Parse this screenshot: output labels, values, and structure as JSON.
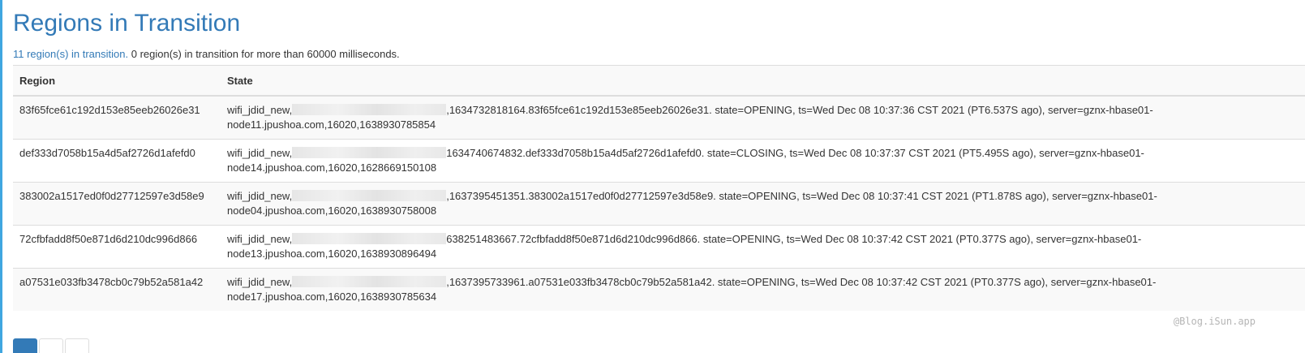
{
  "page": {
    "title": "Regions in Transition",
    "summary_link": "11 region(s) in transition.",
    "summary_text": " 0 region(s) in transition for more than 60000 milliseconds."
  },
  "table": {
    "columns": [
      "Region",
      "State"
    ],
    "rows": [
      {
        "region": "83f65fce61c192d153e85eeb26026e31",
        "state_prefix": "wifi_jdid_new,",
        "state_suffix": ",1634732818164.83f65fce61c192d153e85eeb26026e31. state=OPENING, ts=Wed Dec 08 10:37:36 CST 2021 (PT6.537S ago), server=gznx-hbase01-node11.jpushoa.com,16020,1638930785854"
      },
      {
        "region": "def333d7058b15a4d5af2726d1afefd0",
        "state_prefix": "wifi_jdid_new,",
        "state_suffix": "1634740674832.def333d7058b15a4d5af2726d1afefd0. state=CLOSING, ts=Wed Dec 08 10:37:37 CST 2021 (PT5.495S ago), server=gznx-hbase01-node14.jpushoa.com,16020,1628669150108"
      },
      {
        "region": "383002a1517ed0f0d27712597e3d58e9",
        "state_prefix": "wifi_jdid_new,",
        "state_suffix": ",1637395451351.383002a1517ed0f0d27712597e3d58e9. state=OPENING, ts=Wed Dec 08 10:37:41 CST 2021 (PT1.878S ago), server=gznx-hbase01-node04.jpushoa.com,16020,1638930758008"
      },
      {
        "region": "72cfbfadd8f50e871d6d210dc996d866",
        "state_prefix": "wifi_jdid_new,",
        "state_suffix": "638251483667.72cfbfadd8f50e871d6d210dc996d866. state=OPENING, ts=Wed Dec 08 10:37:42 CST 2021 (PT0.377S ago), server=gznx-hbase01-node13.jpushoa.com,16020,1638930896494"
      },
      {
        "region": "a07531e033fb3478cb0c79b52a581a42",
        "state_prefix": "wifi_jdid_new,",
        "state_suffix": ",1637395733961.a07531e033fb3478cb0c79b52a581a42. state=OPENING, ts=Wed Dec 08 10:37:42 CST 2021 (PT0.377S ago), server=gznx-hbase01-node17.jpushoa.com,16020,1638930785634"
      }
    ]
  },
  "watermark": "@Blog.iSun.app",
  "colors": {
    "accent": "#337ab7",
    "left_rule": "#3fa6e0"
  }
}
